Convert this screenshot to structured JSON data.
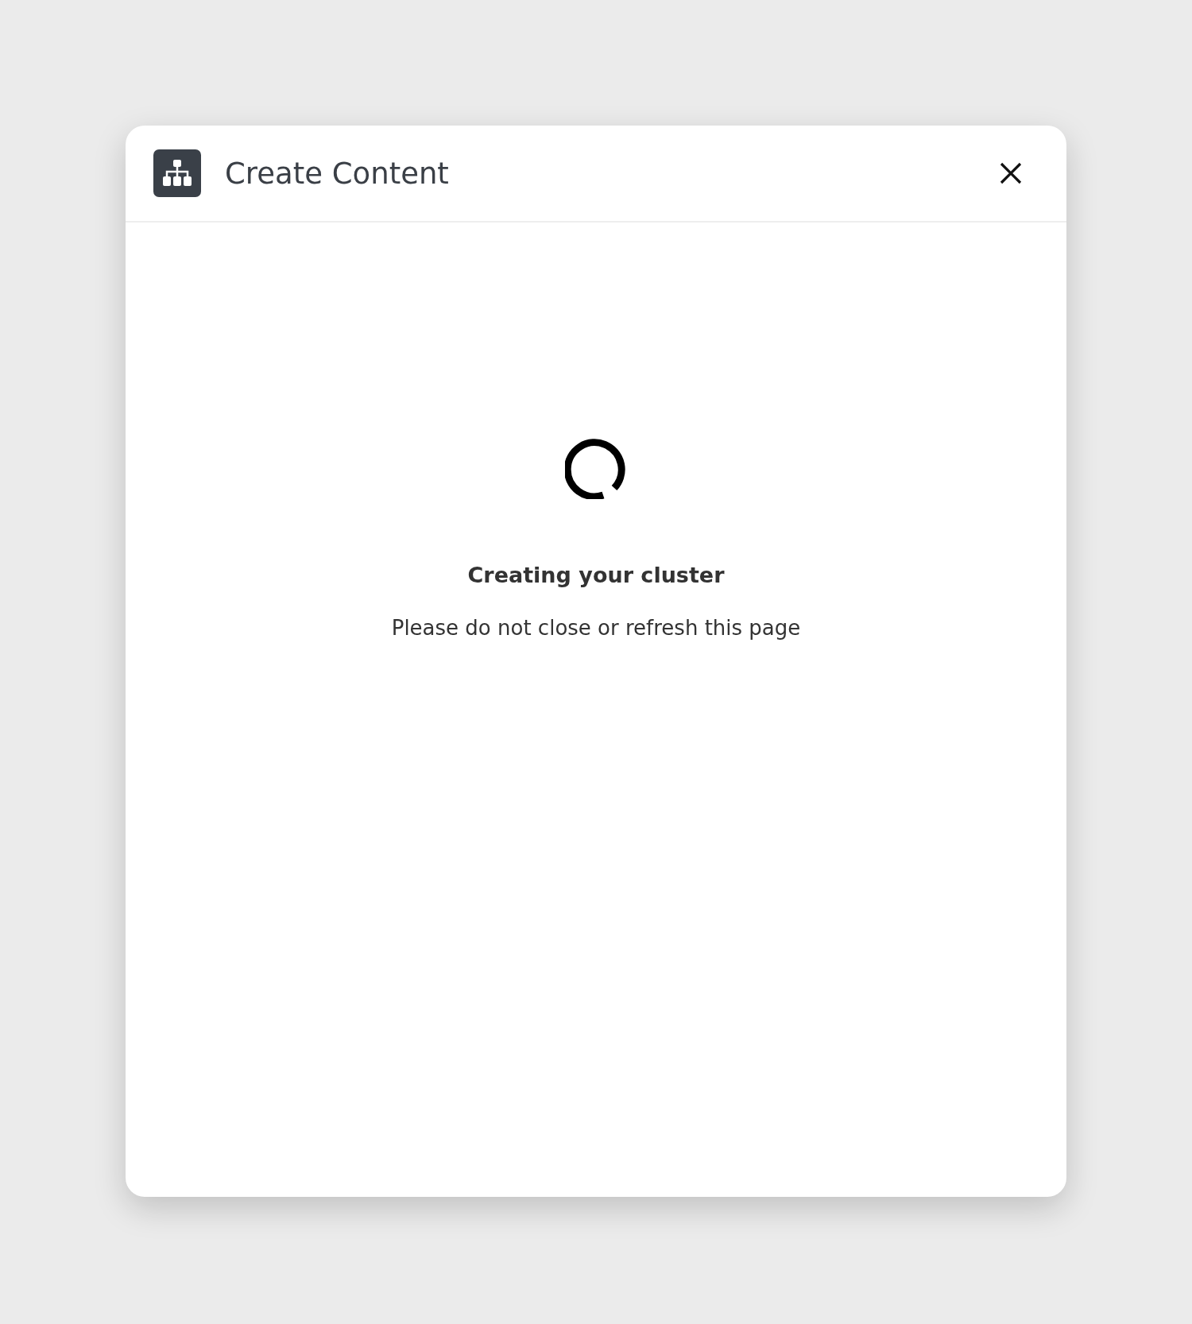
{
  "dialog": {
    "title": "Create Content",
    "status": {
      "heading": "Creating your cluster",
      "message": "Please do not close or refresh this page"
    }
  }
}
